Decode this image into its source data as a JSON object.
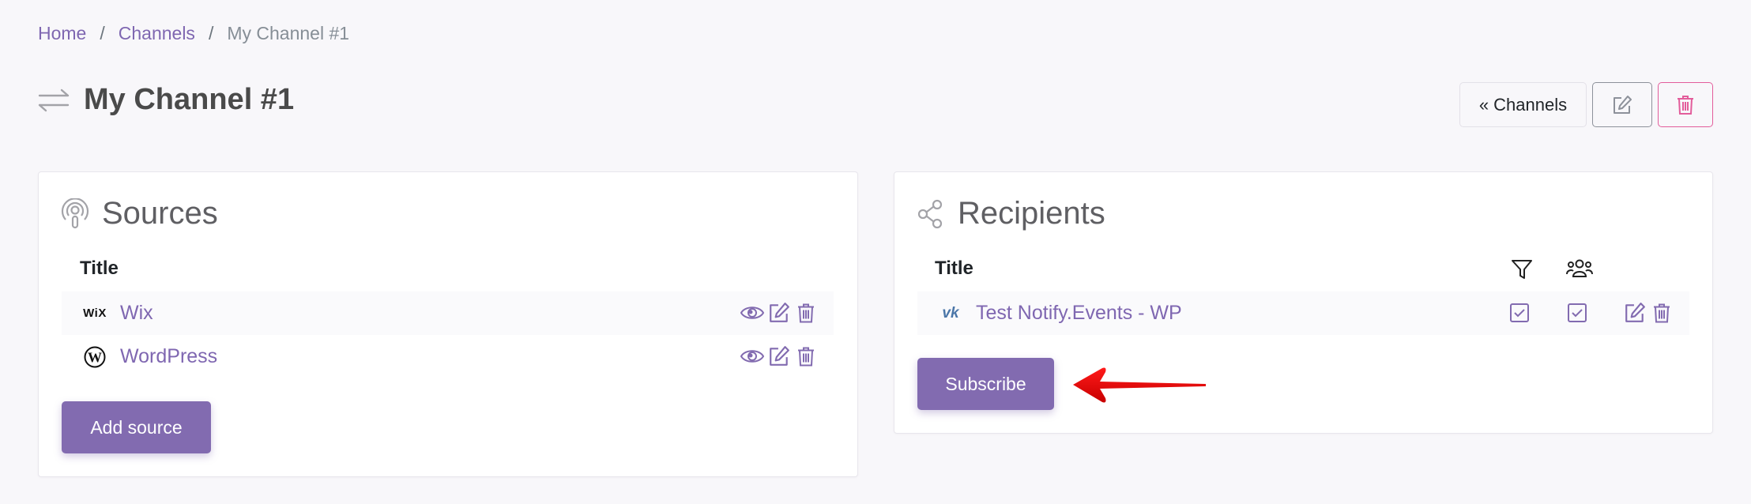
{
  "breadcrumb": {
    "items": [
      {
        "label": "Home",
        "link": true
      },
      {
        "label": "Channels",
        "link": true
      },
      {
        "label": "My Channel #1",
        "link": false
      }
    ],
    "separator": "/"
  },
  "page": {
    "title": "My Channel #1",
    "icon": "swap-arrows-icon"
  },
  "header_actions": {
    "back_label": "Channels",
    "back_icon": "«",
    "edit_icon": "edit-icon",
    "delete_icon": "trash-icon"
  },
  "sources": {
    "title": "Sources",
    "icon": "podcast-icon",
    "column_title": "Title",
    "items": [
      {
        "name": "Wix",
        "logo": "wix-logo",
        "logo_text": "WiX",
        "actions": [
          "view",
          "edit",
          "delete"
        ]
      },
      {
        "name": "WordPress",
        "logo": "wordpress-logo",
        "actions": [
          "view",
          "edit",
          "delete"
        ]
      }
    ],
    "add_label": "Add source"
  },
  "recipients": {
    "title": "Recipients",
    "icon": "share-icon",
    "columns": {
      "title": "Title",
      "filter_icon": "filter-icon",
      "group_icon": "users-icon"
    },
    "items": [
      {
        "name": "Test Notify.Events - WP",
        "logo": "vk-logo",
        "filter": true,
        "group": true,
        "actions": [
          "edit",
          "delete"
        ]
      }
    ],
    "subscribe_label": "Subscribe"
  },
  "annotation": {
    "type": "arrow",
    "color": "#e00000",
    "points_to": "Subscribe"
  },
  "colors": {
    "accent": "#826bb0",
    "link": "#7f67b1",
    "danger": "#e35d9b",
    "background": "#f8f7fa"
  }
}
